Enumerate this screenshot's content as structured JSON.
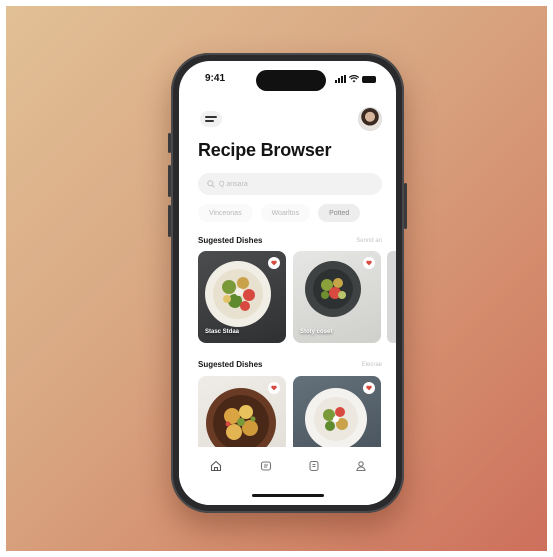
{
  "status": {
    "time": "9:41"
  },
  "header": {
    "title": "Recipe Browser"
  },
  "search": {
    "placeholder": "Q ansara"
  },
  "chips": [
    {
      "label": "Vinceonas"
    },
    {
      "label": "Woarltos"
    },
    {
      "label": "Potted"
    }
  ],
  "sections": [
    {
      "title": "Sugested Dishes",
      "link": "Sennd an",
      "cards": [
        {
          "label": "Stasc Stdaa"
        },
        {
          "label": "Stoty coset"
        }
      ]
    },
    {
      "title": "Sugested Dishes",
      "link": "Elecrae",
      "cards": [
        {
          "label": ""
        },
        {
          "label": ""
        }
      ]
    }
  ],
  "tabbar": {
    "icons": [
      "home-icon",
      "recipes-icon",
      "saved-icon",
      "profile-icon"
    ]
  },
  "colors": {
    "background_start": "#e2c096",
    "background_end": "#cd6f5c",
    "accent_red": "#d84a3f"
  }
}
